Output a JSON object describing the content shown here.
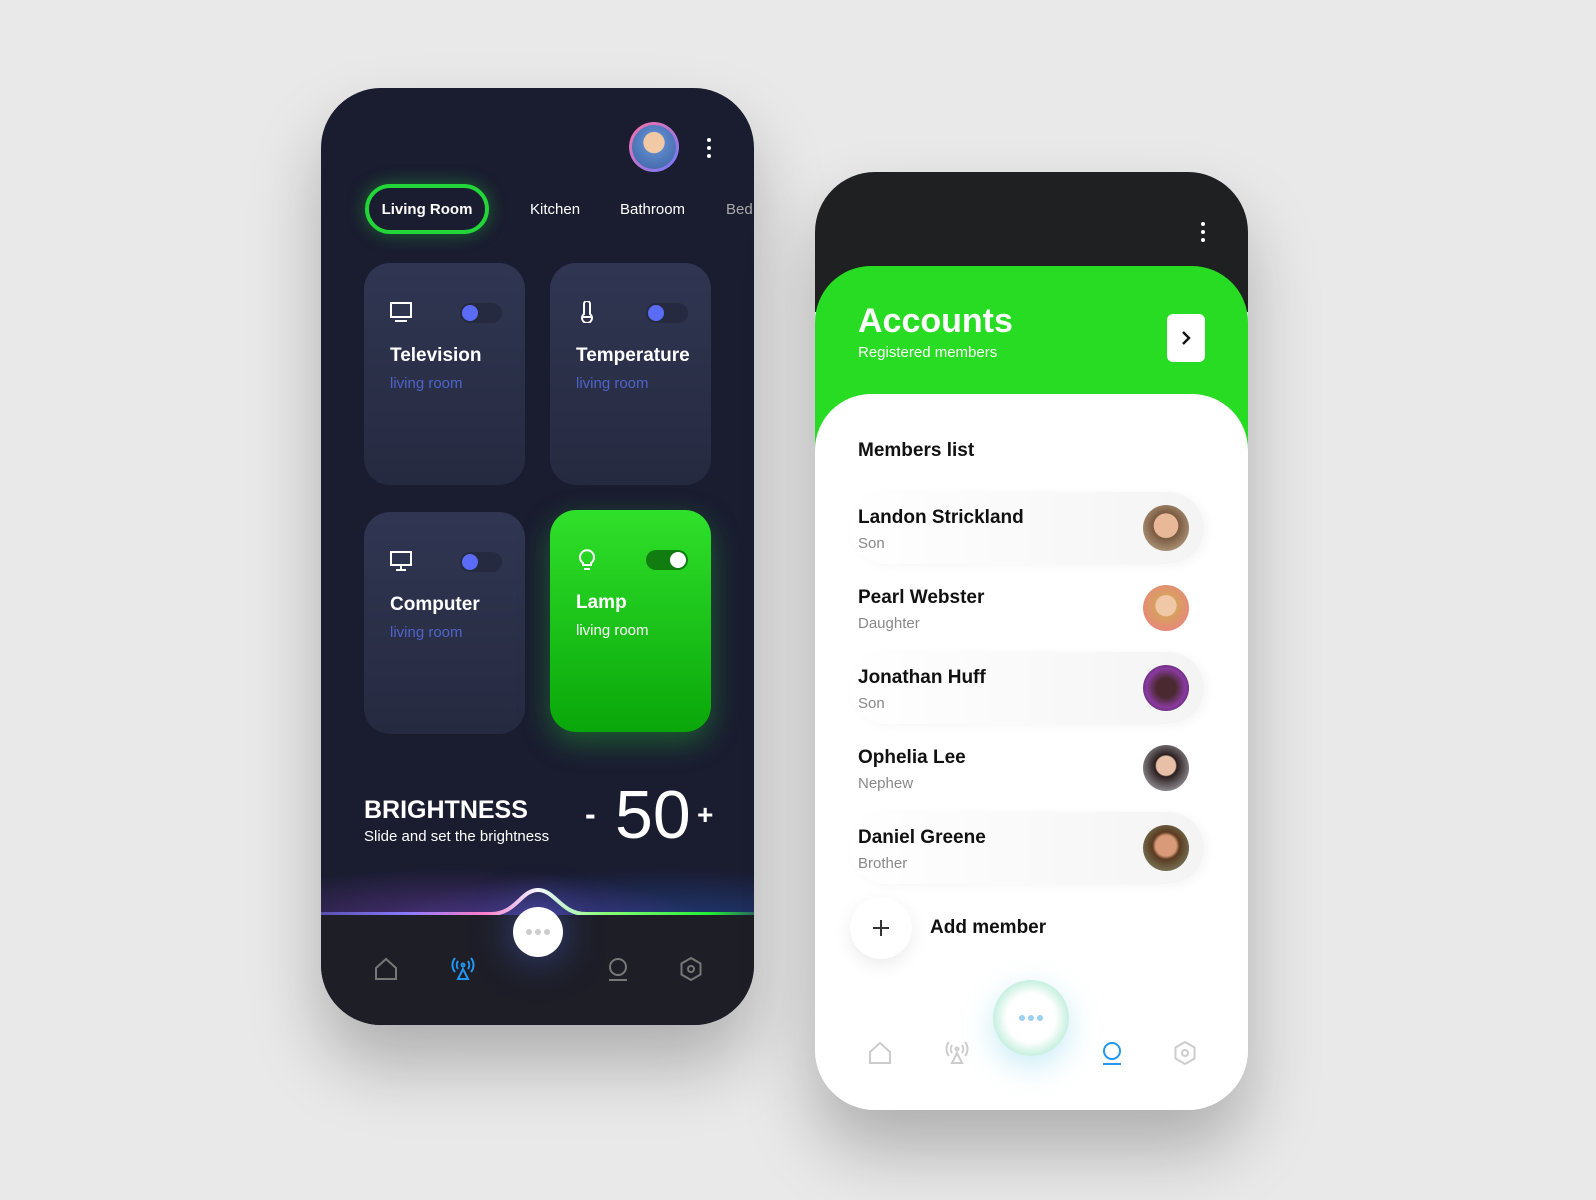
{
  "home": {
    "tabs": [
      {
        "label": "Living Room",
        "active": true
      },
      {
        "label": "Kitchen"
      },
      {
        "label": "Bathroom"
      },
      {
        "label": "Bed"
      }
    ],
    "devices": [
      {
        "name": "Television",
        "room": "living room",
        "icon": "tv-icon",
        "on": false
      },
      {
        "name": "Temperature",
        "room": "living room",
        "icon": "thermometer-icon",
        "on": false
      },
      {
        "name": "Computer",
        "room": "living room",
        "icon": "monitor-icon",
        "on": false
      },
      {
        "name": "Lamp",
        "room": "living room",
        "icon": "bulb-icon",
        "on": true
      }
    ],
    "brightness": {
      "title": "BRIGHTNESS",
      "subtitle": "Slide and set the brightness",
      "value": "50",
      "minus": "-",
      "plus": "+"
    },
    "nav": [
      "home-icon",
      "broadcast-icon",
      "more-icon",
      "user-icon",
      "settings-icon"
    ],
    "nav_active": "broadcast-icon"
  },
  "accounts": {
    "title": "Accounts",
    "subtitle": "Registered members",
    "list_title": "Members list",
    "members": [
      {
        "name": "Landon Strickland",
        "role": "Son"
      },
      {
        "name": "Pearl Webster",
        "role": "Daughter"
      },
      {
        "name": "Jonathan Huff",
        "role": "Son"
      },
      {
        "name": "Ophelia Lee",
        "role": "Nephew"
      },
      {
        "name": "Daniel Greene",
        "role": "Brother"
      }
    ],
    "add_label": "Add member",
    "nav_active": "user-icon"
  },
  "colors": {
    "accent": "#22d63a",
    "dark_bg": "#1a1c30",
    "toggle": "#5a6cf5",
    "nav_active": "#2196f3"
  }
}
